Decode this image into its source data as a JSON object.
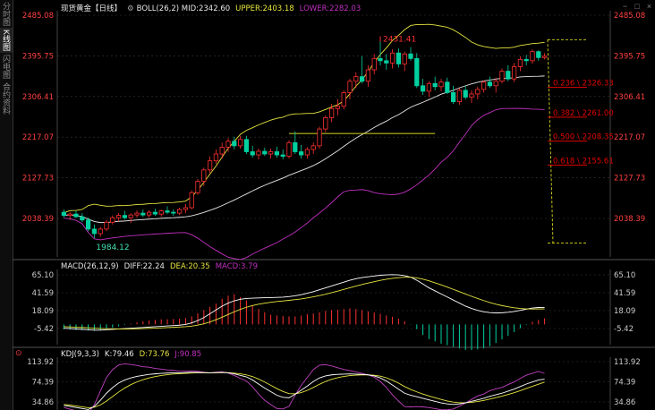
{
  "sidebar": {
    "tabs": [
      {
        "label": "分时图",
        "active": false
      },
      {
        "label": "K线图",
        "active": true
      },
      {
        "label": "闪电图",
        "active": false
      },
      {
        "label": "合约资料",
        "active": false
      }
    ]
  },
  "window_controls": [
    "−",
    "□",
    "×"
  ],
  "colors": {
    "up": "#ff3030",
    "down": "#00d0a0",
    "upper": "#e5e540",
    "mid": "#e8e8e8",
    "lower": "#c030c0",
    "fib": "#e00000",
    "fibline": "#d8d820",
    "axis": "#ff4040",
    "grid": "#3a3a3a",
    "macd_diff": "#ffffff",
    "macd_dea": "#e5e540",
    "kdj_j": "#c040c0"
  },
  "main_header": {
    "symbol": "现货黄金【日线】",
    "boll": "BOLL(26,2) MID:2342.60",
    "upper": "UPPER:2403.18",
    "lower": "LOWER:2282.03"
  },
  "macd_header": {
    "name": "MACD(26,12,9)",
    "diff": "DIFF:22.24",
    "dea": "DEA:20.35",
    "macd": "MACD:3.79"
  },
  "kdj_header": {
    "name": "KDJ(9,3,3)",
    "k": "K:79.46",
    "d": "D:73.76",
    "j": "J:90.85"
  },
  "chart_data": [
    {
      "type": "candlestick",
      "title": "现货黄金【日线】",
      "yticks": [
        "2485.08",
        "2395.75",
        "2306.41",
        "2217.07",
        "2127.73",
        "2038.39"
      ],
      "ylim": [
        1995,
        2485.08
      ],
      "annotations": {
        "high": "2431.41",
        "low": "1984.12"
      },
      "fibonacci": [
        {
          "label": "0.236 \\ 2326.33",
          "value": 2326.33
        },
        {
          "label": "0.382 \\ 2261.00",
          "value": 2261.0
        },
        {
          "label": "0.500 \\ 2208.35",
          "value": 2208.35
        },
        {
          "label": "0.618 \\ 2155.61",
          "value": 2155.61
        }
      ],
      "fib_range": [
        2431.41,
        1984.12
      ],
      "resistance": 2225,
      "ohlc": [
        [
          2052,
          2058,
          2040,
          2045
        ],
        [
          2045,
          2052,
          2035,
          2048
        ],
        [
          2048,
          2055,
          2040,
          2042
        ],
        [
          2042,
          2050,
          2030,
          2035
        ],
        [
          2035,
          2040,
          2010,
          2015
        ],
        [
          2015,
          2025,
          1995,
          2005
        ],
        [
          2005,
          2020,
          1998,
          2015
        ],
        [
          2015,
          2035,
          2010,
          2030
        ],
        [
          2030,
          2045,
          2025,
          2040
        ],
        [
          2040,
          2050,
          2032,
          2045
        ],
        [
          2045,
          2055,
          2036,
          2040
        ],
        [
          2040,
          2050,
          2028,
          2046
        ],
        [
          2046,
          2056,
          2040,
          2050
        ],
        [
          2050,
          2058,
          2042,
          2046
        ],
        [
          2046,
          2056,
          2040,
          2052
        ],
        [
          2052,
          2060,
          2044,
          2048
        ],
        [
          2048,
          2058,
          2042,
          2055
        ],
        [
          2055,
          2065,
          2048,
          2052
        ],
        [
          2052,
          2058,
          2044,
          2050
        ],
        [
          2050,
          2062,
          2046,
          2058
        ],
        [
          2058,
          2070,
          2050,
          2062
        ],
        [
          2062,
          2100,
          2058,
          2095
        ],
        [
          2095,
          2125,
          2090,
          2120
        ],
        [
          2120,
          2150,
          2110,
          2145
        ],
        [
          2145,
          2175,
          2138,
          2165
        ],
        [
          2165,
          2190,
          2158,
          2180
        ],
        [
          2180,
          2205,
          2170,
          2195
        ],
        [
          2195,
          2215,
          2185,
          2208
        ],
        [
          2208,
          2218,
          2190,
          2198
        ],
        [
          2198,
          2220,
          2192,
          2212
        ],
        [
          2212,
          2220,
          2180,
          2185
        ],
        [
          2185,
          2198,
          2172,
          2178
        ],
        [
          2178,
          2192,
          2168,
          2186
        ],
        [
          2186,
          2194,
          2176,
          2180
        ],
        [
          2180,
          2192,
          2170,
          2185
        ],
        [
          2185,
          2196,
          2172,
          2178
        ],
        [
          2178,
          2190,
          2168,
          2175
        ],
        [
          2175,
          2210,
          2170,
          2205
        ],
        [
          2205,
          2230,
          2180,
          2185
        ],
        [
          2185,
          2200,
          2170,
          2178
        ],
        [
          2178,
          2195,
          2170,
          2190
        ],
        [
          2190,
          2205,
          2180,
          2198
        ],
        [
          2198,
          2240,
          2192,
          2235
        ],
        [
          2235,
          2265,
          2228,
          2260
        ],
        [
          2260,
          2290,
          2250,
          2280
        ],
        [
          2280,
          2300,
          2265,
          2285
        ],
        [
          2285,
          2320,
          2278,
          2315
        ],
        [
          2315,
          2345,
          2300,
          2340
        ],
        [
          2340,
          2360,
          2325,
          2350
        ],
        [
          2350,
          2395,
          2335,
          2340
        ],
        [
          2340,
          2375,
          2328,
          2365
        ],
        [
          2365,
          2400,
          2355,
          2390
        ],
        [
          2390,
          2431,
          2375,
          2385
        ],
        [
          2385,
          2400,
          2365,
          2380
        ],
        [
          2380,
          2410,
          2368,
          2402
        ],
        [
          2402,
          2412,
          2370,
          2378
        ],
        [
          2378,
          2405,
          2362,
          2400
        ],
        [
          2400,
          2415,
          2385,
          2390
        ],
        [
          2390,
          2402,
          2325,
          2330
        ],
        [
          2330,
          2345,
          2310,
          2318
        ],
        [
          2318,
          2340,
          2305,
          2335
        ],
        [
          2335,
          2350,
          2320,
          2328
        ],
        [
          2328,
          2345,
          2318,
          2338
        ],
        [
          2338,
          2348,
          2312,
          2315
        ],
        [
          2315,
          2330,
          2290,
          2295
        ],
        [
          2295,
          2325,
          2288,
          2320
        ],
        [
          2320,
          2330,
          2300,
          2305
        ],
        [
          2305,
          2320,
          2292,
          2312
        ],
        [
          2312,
          2328,
          2300,
          2322
        ],
        [
          2322,
          2342,
          2315,
          2338
        ],
        [
          2338,
          2350,
          2325,
          2330
        ],
        [
          2330,
          2348,
          2315,
          2340
        ],
        [
          2340,
          2368,
          2335,
          2362
        ],
        [
          2362,
          2375,
          2340,
          2345
        ],
        [
          2345,
          2380,
          2338,
          2372
        ],
        [
          2372,
          2395,
          2362,
          2388
        ],
        [
          2388,
          2398,
          2375,
          2385
        ],
        [
          2385,
          2410,
          2378,
          2405
        ],
        [
          2405,
          2408,
          2385,
          2392
        ],
        [
          2392,
          2402,
          2388,
          2395
        ]
      ]
    },
    {
      "type": "bar+line",
      "title": "MACD(26,12,9)",
      "yticks": [
        "65.10",
        "41.59",
        "18.09",
        "-5.42"
      ],
      "ylim": [
        -30,
        75
      ],
      "diff": [
        -5,
        -5.5,
        -6,
        -6.5,
        -7,
        -7.5,
        -7.5,
        -7,
        -6.5,
        -6,
        -5.5,
        -5,
        -4.5,
        -4,
        -3.5,
        -3,
        -2.5,
        -2,
        -1.5,
        -1,
        0,
        2,
        5,
        9,
        14,
        19,
        24,
        28,
        31,
        33,
        34,
        34.5,
        34.8,
        35,
        35.2,
        35.5,
        35.8,
        36.5,
        37.5,
        39,
        41,
        43,
        45.5,
        48,
        50.5,
        53,
        55.5,
        58,
        60,
        61.5,
        62.5,
        63.5,
        64.5,
        65,
        65.3,
        65,
        64,
        62,
        58,
        53,
        48,
        44,
        40,
        36,
        32,
        28,
        24,
        21,
        18.5,
        16.5,
        15.5,
        15,
        15.3,
        16,
        17,
        18.5,
        20,
        21.5,
        22.2,
        22.24
      ],
      "dea": [
        -3,
        -3.3,
        -3.7,
        -4.1,
        -4.5,
        -4.9,
        -5.3,
        -5.6,
        -5.8,
        -6,
        -6,
        -5.9,
        -5.7,
        -5.5,
        -5.2,
        -4.9,
        -4.6,
        -4.2,
        -3.8,
        -3.4,
        -3,
        -2.2,
        -1,
        0.8,
        3.2,
        6.1,
        9.5,
        13,
        16.5,
        19.8,
        22.5,
        24.8,
        26.5,
        27.9,
        29,
        30,
        30.8,
        31.6,
        32.5,
        33.5,
        34.8,
        36.2,
        37.8,
        39.6,
        41.6,
        43.7,
        45.9,
        48.1,
        50.3,
        52.4,
        54.3,
        56.1,
        57.8,
        59.3,
        60.5,
        61.4,
        61.9,
        61.9,
        61.1,
        59.5,
        57.2,
        54.6,
        51.9,
        49,
        46,
        43,
        39.9,
        36.9,
        34,
        31.3,
        28.8,
        26.6,
        24.7,
        23.1,
        21.8,
        20.9,
        20.4,
        20.2,
        20.3,
        20.35
      ],
      "macd": [
        -1.5,
        -1.6,
        -1.7,
        -1.8,
        -1.9,
        -2,
        -1.7,
        -1.4,
        -1,
        -0.6,
        -0.2,
        0.2,
        0.6,
        1,
        1.2,
        1.4,
        1.6,
        1.6,
        1.7,
        1.8,
        2,
        2.5,
        3.5,
        4.5,
        5.5,
        6.5,
        8,
        9,
        9.5,
        8.5,
        7.5,
        6,
        4.8,
        3.8,
        3,
        2.8,
        2.6,
        2.5,
        2.5,
        2.8,
        3.2,
        3.4,
        3.8,
        4.2,
        4.5,
        4.6,
        4.8,
        5,
        4.8,
        4.5,
        4.1,
        3.7,
        3.3,
        2.8,
        2.4,
        1.8,
        1,
        -0.1,
        -1.5,
        -3.3,
        -4.6,
        -5.3,
        -6,
        -6.5,
        -7,
        -7.5,
        -8,
        -8,
        -7.8,
        -7.5,
        -6.8,
        -5.8,
        -4.7,
        -3.6,
        -2.4,
        -1.2,
        -0.2,
        0.8,
        1.4,
        1.9
      ]
    },
    {
      "type": "line",
      "title": "KDJ(9,3,3)",
      "yticks": [
        "113.92",
        "74.39",
        "34.86"
      ],
      "ylim": [
        25,
        125
      ],
      "k": [
        28,
        26,
        24,
        22,
        20,
        26,
        38,
        52,
        63,
        72,
        78,
        82,
        85,
        87,
        89,
        90,
        91,
        91.5,
        92,
        92,
        92.5,
        93,
        93,
        92.5,
        92,
        92.5,
        93,
        92,
        90,
        87,
        84,
        78,
        70,
        62,
        55,
        48,
        44,
        43,
        50,
        58,
        66,
        75,
        82,
        86,
        88,
        89,
        89.5,
        89.8,
        89.5,
        89,
        88,
        86,
        82,
        76,
        68,
        60,
        52,
        48,
        45,
        42,
        39,
        36,
        33,
        31,
        30,
        31,
        33,
        36,
        39,
        42,
        46,
        49,
        52,
        56,
        60,
        65,
        70,
        74,
        78,
        79.46
      ],
      "d": [
        30,
        28.7,
        27.1,
        25.4,
        23.6,
        24.4,
        28.9,
        36.6,
        45.4,
        54.3,
        62.2,
        68.8,
        74.2,
        78.5,
        82,
        84.7,
        86.8,
        88.4,
        89.6,
        90.4,
        91.1,
        91.7,
        92.1,
        92.2,
        92.1,
        92.2,
        92.5,
        92.3,
        91.5,
        90,
        88,
        84.7,
        79.8,
        73.9,
        67.6,
        61.1,
        55.4,
        51.3,
        50.9,
        53.3,
        57.5,
        63.3,
        69.5,
        75,
        79.3,
        82.5,
        84.9,
        86.5,
        87.5,
        88,
        88,
        87.3,
        85.5,
        82.3,
        77.6,
        71.7,
        65.1,
        59.4,
        54.6,
        50.4,
        46.6,
        43.1,
        39.7,
        36.8,
        34.5,
        33.3,
        33.2,
        34.1,
        35.7,
        37.8,
        40.5,
        43.3,
        46.2,
        49.5,
        53,
        57,
        61.3,
        65.5,
        69.7,
        73.76
      ],
      "j": [
        24,
        20.6,
        17.8,
        15.2,
        12.8,
        29.2,
        56.2,
        82.8,
        98.2,
        107.4,
        109.6,
        108.4,
        106.6,
        104,
        103,
        100.6,
        99.4,
        97.7,
        96.8,
        95.2,
        95.3,
        95.6,
        94.8,
        93.1,
        91.8,
        93.1,
        94,
        91.4,
        87,
        81,
        76,
        64.6,
        50.4,
        38.2,
        29.8,
        21.8,
        21.2,
        26.4,
        48.2,
        67.4,
        83,
        98.4,
        107,
        108,
        105.4,
        102,
        98.7,
        96.4,
        93.5,
        91,
        88,
        83.4,
        75,
        63.4,
        48.8,
        36.6,
        25.8,
        25.2,
        25.8,
        25.2,
        23.8,
        21.8,
        19.6,
        19.4,
        21,
        26.4,
        32.6,
        39.8,
        46.6,
        50.4,
        57,
        60.4,
        63.6,
        69,
        74,
        81,
        87.4,
        91,
        94.6,
        90.85
      ]
    }
  ]
}
